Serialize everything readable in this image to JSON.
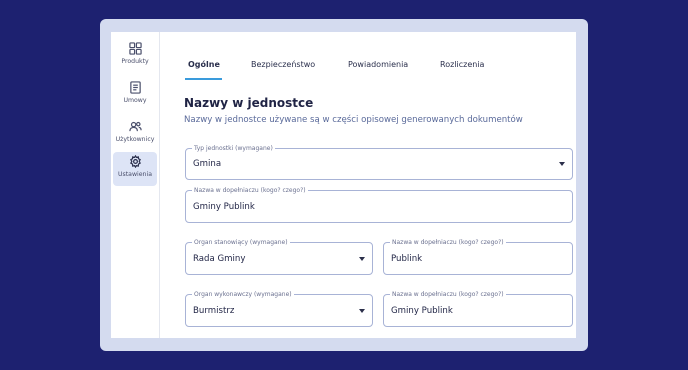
{
  "sidebar": {
    "items": [
      {
        "label": "Produkty",
        "icon": "grid-icon"
      },
      {
        "label": "Umowy",
        "icon": "document-icon"
      },
      {
        "label": "Użytkownicy",
        "icon": "users-icon"
      },
      {
        "label": "Ustawienia",
        "icon": "gear-icon",
        "active": true
      }
    ]
  },
  "tabs": [
    {
      "label": "Ogólne",
      "active": true
    },
    {
      "label": "Bezpieczeństwo"
    },
    {
      "label": "Powiadomienia"
    },
    {
      "label": "Rozliczenia"
    }
  ],
  "section": {
    "title": "Nazwy w jednostce",
    "description": "Nazwy w jednostce używane są w części opisowej generowanych dokumentów"
  },
  "form": {
    "unit_type": {
      "label": "Typ jednostki (wymagane)",
      "value": "Gmina"
    },
    "unit_genitive": {
      "label": "Nazwa w dopełniaczu (kogo? czego?)",
      "value": "Gminy Publink"
    },
    "legislative": {
      "label": "Organ stanowiący (wymagane)",
      "value": "Rada Gminy"
    },
    "legislative_genitive": {
      "label": "Nazwa w dopełniaczu (kogo? czego?)",
      "value": "Publink"
    },
    "executive": {
      "label": "Organ wykonawczy (wymagane)",
      "value": "Burmistrz"
    },
    "executive_genitive": {
      "label": "Nazwa w dopełniaczu (kogo? czego?)",
      "value": "Gminy Publink"
    }
  },
  "colors": {
    "background": "#1d2170",
    "accent": "#3a9bdc",
    "active_item": "#dde4f6"
  }
}
